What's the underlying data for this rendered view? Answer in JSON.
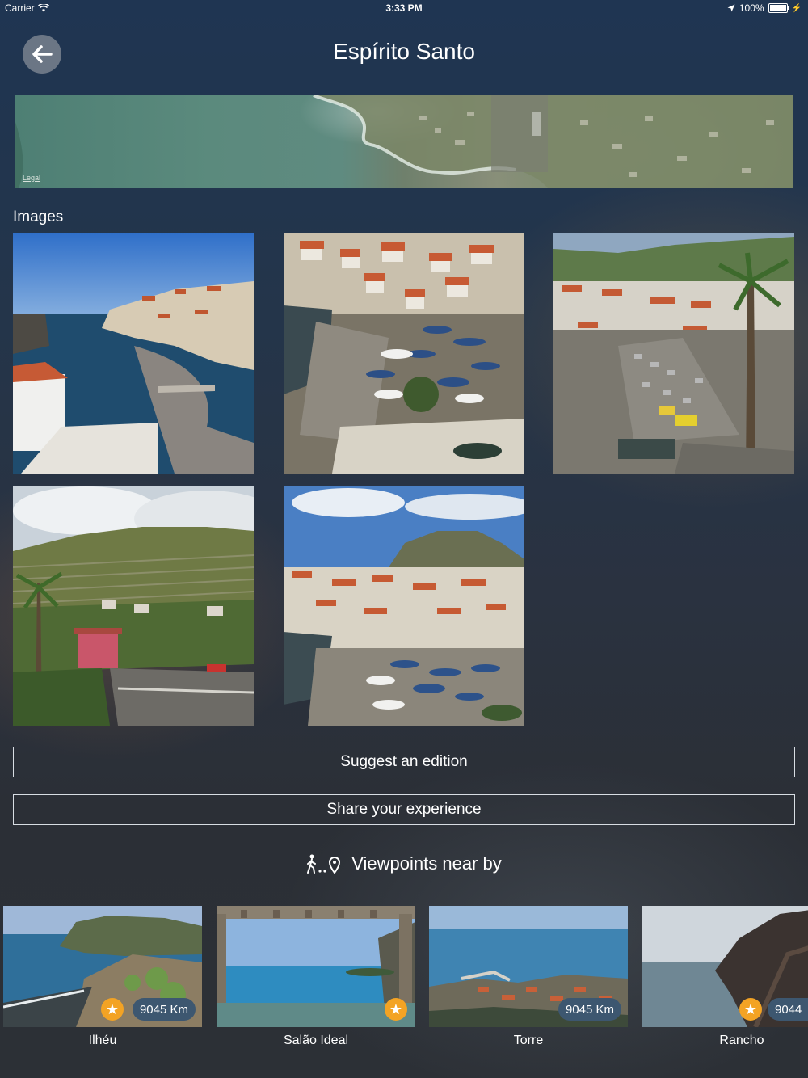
{
  "status_bar": {
    "carrier": "Carrier",
    "time": "3:33 PM",
    "battery": "100%"
  },
  "header": {
    "title": "Espírito Santo"
  },
  "map": {
    "legal_label": "Legal"
  },
  "images_section": {
    "label": "Images",
    "count": 5
  },
  "actions": {
    "suggest_label": "Suggest an edition",
    "share_label": "Share your experience"
  },
  "nearby": {
    "title": "Viewpoints near by",
    "items": [
      {
        "name": "Ilhéu",
        "distance": "9045 Km",
        "starred": true
      },
      {
        "name": "Salão Ideal",
        "distance": "",
        "starred": true
      },
      {
        "name": "Torre",
        "distance": "9045 Km",
        "starred": false
      },
      {
        "name": "Rancho",
        "distance": "9044",
        "starred": true
      }
    ]
  },
  "colors": {
    "star": "#f3a324",
    "distance_badge": "#3d5770",
    "back_button": "#6b7685"
  }
}
